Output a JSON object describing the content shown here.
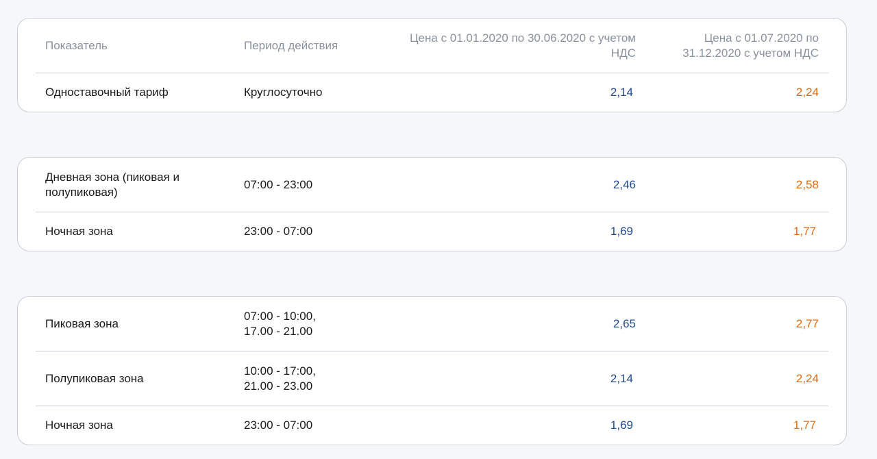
{
  "colors": {
    "old_price": "#1f4a8c",
    "new_price": "#dc6a15",
    "border": "#c9ced6",
    "header_text": "#8a92a0"
  },
  "header": {
    "indicator": "Показатель",
    "period": "Период действия",
    "price1": "Цена с 01.01.2020 по 30.06.2020 с учетом НДС",
    "price2": "Цена с 01.07.2020 по 31.12.2020 с учетом НДС"
  },
  "table1": {
    "rows": [
      {
        "name": "Одноставочный тариф",
        "period": "Круглосуточно",
        "price1": "2,14",
        "price2": "2,24"
      }
    ]
  },
  "table2": {
    "rows": [
      {
        "name": "Дневная зона (пиковая и полупиковая)",
        "period": "07:00 - 23:00",
        "price1": "2,46",
        "price2": "2,58"
      },
      {
        "name": "Ночная зона",
        "period": "23:00 - 07:00",
        "price1": "1,69",
        "price2": "1,77"
      }
    ]
  },
  "table3": {
    "rows": [
      {
        "name": "Пиковая зона",
        "period_line1": "07:00 - 10:00,",
        "period_line2": "17.00 - 21.00",
        "price1": "2,65",
        "price2": "2,77"
      },
      {
        "name": "Полупиковая зона",
        "period_line1": "10:00 - 17:00,",
        "period_line2": "21.00 - 23.00",
        "price1": "2,14",
        "price2": "2,24"
      },
      {
        "name": "Ночная зона",
        "period": "23:00 - 07:00",
        "price1": "1,69",
        "price2": "1,77"
      }
    ]
  }
}
